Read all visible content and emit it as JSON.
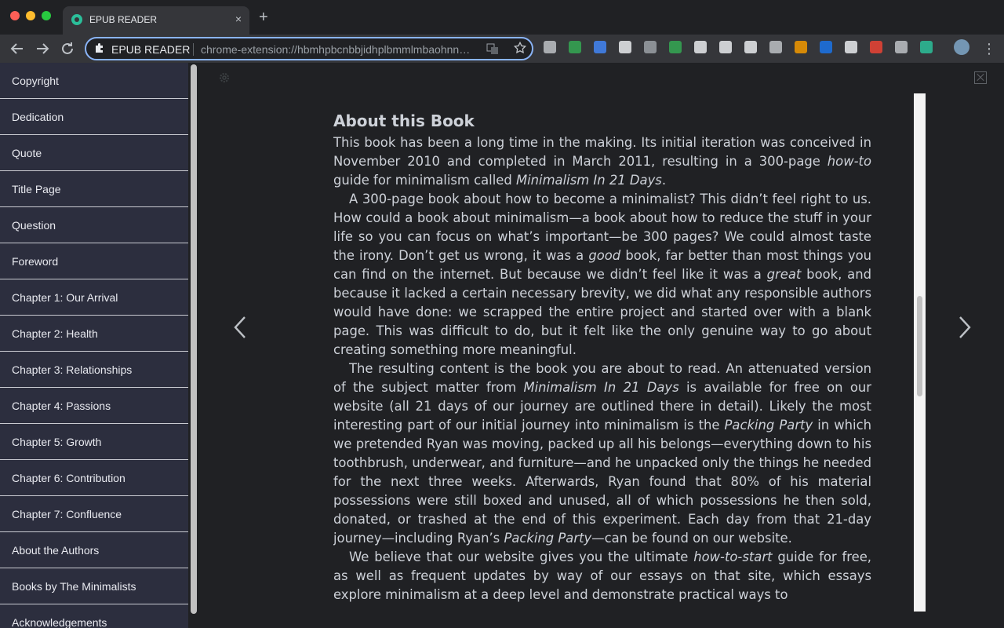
{
  "browser": {
    "tab_title": "EPUB READER",
    "tab_close": "×",
    "new_tab": "+",
    "omnibox_name": "EPUB READER",
    "omnibox_url": "chrome-extension://hbmhpbcnbbjidhplbmmlmbaohnnmbdnmm/index.html",
    "menu": "⋮",
    "extension_icons": [
      {
        "name": "qr-code-icon",
        "color": "#bdc1c6"
      },
      {
        "name": "screenshot-icon",
        "color": "#34a853"
      },
      {
        "name": "translate-icon",
        "color": "#4285f4"
      },
      {
        "name": "circle-icon",
        "color": "#e8eaed"
      },
      {
        "name": "vue-icon",
        "color": "#9aa0a6"
      },
      {
        "name": "shield-icon",
        "color": "#34a853"
      },
      {
        "name": "code-icon",
        "color": "#e8eaed"
      },
      {
        "name": "react-icon",
        "color": "#e8eaed"
      },
      {
        "name": "target-icon",
        "color": "#e8eaed"
      },
      {
        "name": "info-icon",
        "color": "#bdc1c6"
      },
      {
        "name": "download-icon",
        "color": "#f29900"
      },
      {
        "name": "dropbox-icon",
        "color": "#1a73e8"
      },
      {
        "name": "glasses-icon",
        "color": "#e8eaed"
      },
      {
        "name": "fe-icon",
        "color": "#ea4335"
      },
      {
        "name": "book-icon",
        "color": "#bdc1c6"
      },
      {
        "name": "epub-icon",
        "color": "#2bbf9a"
      },
      {
        "name": "avatar-icon",
        "color": "#7fa7c9"
      }
    ]
  },
  "toc": {
    "items": [
      {
        "label": "Copyright"
      },
      {
        "label": "Dedication"
      },
      {
        "label": "Quote"
      },
      {
        "label": "Title Page"
      },
      {
        "label": "Question"
      },
      {
        "label": "Foreword"
      },
      {
        "label": "Chapter 1: Our Arrival"
      },
      {
        "label": "Chapter 2: Health"
      },
      {
        "label": "Chapter 3: Relationships"
      },
      {
        "label": "Chapter 4: Passions"
      },
      {
        "label": "Chapter 5: Growth"
      },
      {
        "label": "Chapter 6: Contribution"
      },
      {
        "label": "Chapter 7: Confluence"
      },
      {
        "label": "About the Authors"
      },
      {
        "label": "Books by The Minimalists"
      },
      {
        "label": "Acknowledgements"
      }
    ]
  },
  "book": {
    "heading": "About this Book",
    "p1": {
      "t1": "This book has been a long time in the making. Its initial iteration was conceived in November 2010 and completed in March 2011, resulting in a 300-page ",
      "i1": "how-to",
      "t2": " guide for minimalism called ",
      "i2": "Minimalism In 21 Days",
      "t3": "."
    },
    "p2": {
      "t1": "A 300-page book about how to become a minimalist? This didn’t feel right to us. How could a book about minimalism—a book about how to reduce the stuff in your life so you can focus on what’s important—be 300 pages? We could almost taste the irony. Don’t get us wrong, it was a ",
      "i1": "good",
      "t2": " book, far better than most things you can find on the internet. But because we didn’t feel like it was a ",
      "i2": "great",
      "t3": " book, and because it lacked a certain necessary brevity, we did what any responsible authors would have done: we scrapped the entire project and started over with a blank page. This was difficult to do, but it felt like the only genuine way to go about creating something more meaningful."
    },
    "p3": {
      "t1": "The resulting content is the book you are about to read. An attenuated version of the subject matter from ",
      "i1": "Minimalism In 21 Days",
      "t2": " is available for free on our website (all 21 days of our journey are outlined there in detail). Likely the most interesting part of our initial journey into minimalism is the ",
      "i2": "Packing Party",
      "t3": " in which we pretended Ryan was moving, packed up all his belongs—everything down to his toothbrush, underwear, and furniture—and he unpacked only the things he needed for the next three weeks. Afterwards, Ryan found that 80% of his material possessions were still boxed and unused, all of which possessions he then sold, donated, or trashed at the end of this experiment. Each day from that 21-day journey—including Ryan’s ",
      "i3": "Packing Party",
      "t4": "—can be found on our website."
    },
    "p4": {
      "t1": "We believe that our website gives you the ultimate ",
      "i1": "how-to-start",
      "t2": " guide for free, as well as frequent updates by way of our essays on that site, which essays explore minimalism at a deep level and demonstrate practical ways to"
    }
  }
}
